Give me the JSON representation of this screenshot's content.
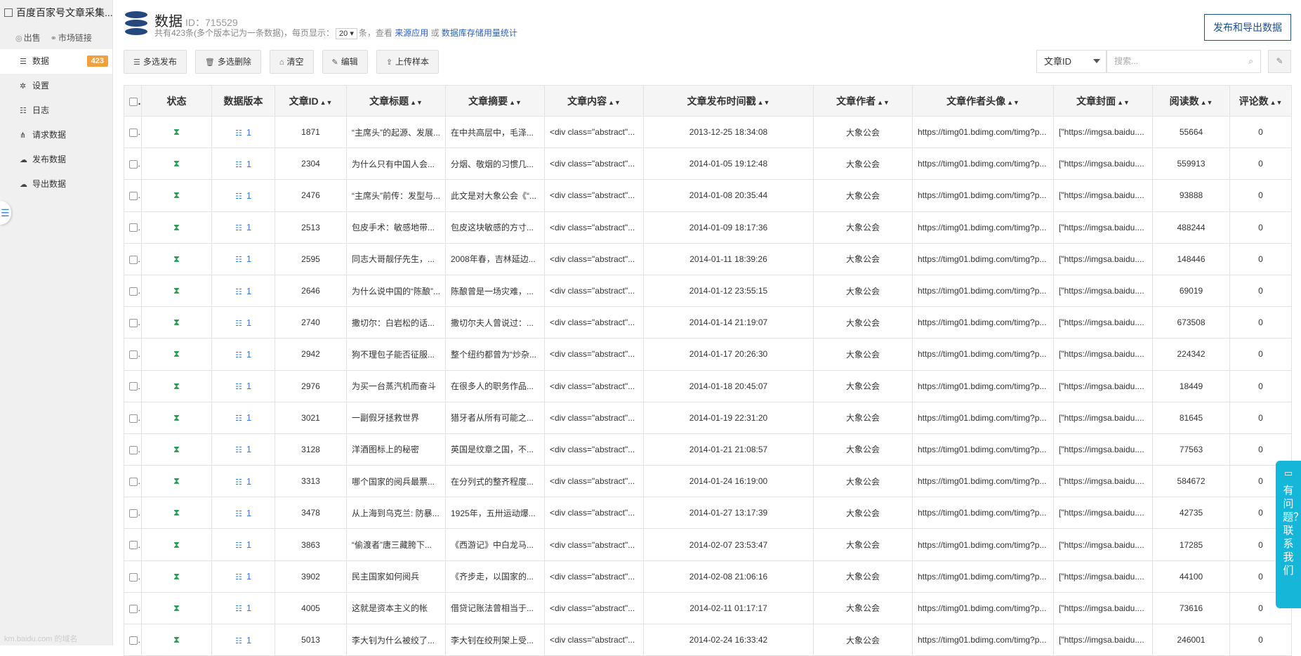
{
  "app": {
    "title": "百度百家号文章采集..."
  },
  "sidebar": {
    "links": [
      {
        "label": "出售"
      },
      {
        "label": "市场链接"
      }
    ],
    "items": [
      {
        "label": "数据",
        "badge": "423"
      },
      {
        "label": "设置"
      },
      {
        "label": "日志"
      },
      {
        "label": "请求数据"
      },
      {
        "label": "发布数据"
      },
      {
        "label": "导出数据"
      }
    ],
    "watermark": "km.baidu.com 的域名"
  },
  "header": {
    "title": "数据",
    "id_text": "ID：715529",
    "sub_prefix": "共有423条(多个版本记为一条数据)，每页显示：",
    "page_size": "20",
    "sub_mid": "条，查看",
    "link_source": "来源应用",
    "sub_or": "或",
    "link_storage": "数据库存储用量统计",
    "publish_button": "发布和导出数据"
  },
  "toolbar": {
    "multi_publish": "多选发布",
    "multi_delete": "多选删除",
    "clear": "清空",
    "edit": "编辑",
    "upload_sample": "上传样本"
  },
  "search": {
    "field": "文章ID",
    "placeholder": "搜索..."
  },
  "table": {
    "columns": [
      "状态",
      "数据版本",
      "文章ID",
      "文章标题",
      "文章摘要",
      "文章内容",
      "文章发布时间戳",
      "文章作者",
      "文章作者头像",
      "文章封面",
      "阅读数",
      "评论数"
    ],
    "rows": [
      [
        "1",
        "1871",
        "“主席头”的起源、发展...",
        "在中共高层中，毛泽...",
        "<div class=\"abstract\"...",
        "2013-12-25 18:34:08",
        "大象公会",
        "https://timg01.bdimg.com/timg?p...",
        "[\"https://imgsa.baidu....",
        "55664",
        "0"
      ],
      [
        "1",
        "2304",
        "为什么只有中国人会...",
        "分烟、敬烟的习惯几...",
        "<div class=\"abstract\"...",
        "2014-01-05 19:12:48",
        "大象公会",
        "https://timg01.bdimg.com/timg?p...",
        "[\"https://imgsa.baidu....",
        "559913",
        "0"
      ],
      [
        "1",
        "2476",
        "“主席头”前传：发型与...",
        "此文是对大象公会《“...",
        "<div class=\"abstract\"...",
        "2014-01-08 20:35:44",
        "大象公会",
        "https://timg01.bdimg.com/timg?p...",
        "[\"https://imgsa.baidu....",
        "93888",
        "0"
      ],
      [
        "1",
        "2513",
        "包皮手术：敏感地带...",
        "包皮这块敏感的方寸...",
        "<div class=\"abstract\"...",
        "2014-01-09 18:17:36",
        "大象公会",
        "https://timg01.bdimg.com/timg?p...",
        "[\"https://imgsa.baidu....",
        "488244",
        "0"
      ],
      [
        "1",
        "2595",
        "同志大哥靓仔先生，...",
        "2008年春，吉林延边...",
        "<div class=\"abstract\"...",
        "2014-01-11 18:39:26",
        "大象公会",
        "https://timg01.bdimg.com/timg?p...",
        "[\"https://imgsa.baidu....",
        "148446",
        "0"
      ],
      [
        "1",
        "2646",
        "为什么说中国的“陈酿”...",
        "陈酿曾是一场灾难，...",
        "<div class=\"abstract\"...",
        "2014-01-12 23:55:15",
        "大象公会",
        "https://timg01.bdimg.com/timg?p...",
        "[\"https://imgsa.baidu....",
        "69019",
        "0"
      ],
      [
        "1",
        "2740",
        "撒切尔：白岩松的话...",
        "撒切尔夫人曾说过：...",
        "<div class=\"abstract\"...",
        "2014-01-14 21:19:07",
        "大象公会",
        "https://timg01.bdimg.com/timg?p...",
        "[\"https://imgsa.baidu....",
        "673508",
        "0"
      ],
      [
        "1",
        "2942",
        "狗不理包子能否征服...",
        "整个纽约都曾为“炒杂...",
        "<div class=\"abstract\"...",
        "2014-01-17 20:26:30",
        "大象公会",
        "https://timg01.bdimg.com/timg?p...",
        "[\"https://imgsa.baidu....",
        "224342",
        "0"
      ],
      [
        "1",
        "2976",
        "为买一台蒸汽机而奋斗",
        "在很多人的职务作品...",
        "<div class=\"abstract\"...",
        "2014-01-18 20:45:07",
        "大象公会",
        "https://timg01.bdimg.com/timg?p...",
        "[\"https://imgsa.baidu....",
        "18449",
        "0"
      ],
      [
        "1",
        "3021",
        "一副假牙拯救世界",
        "猎牙者从所有可能之...",
        "<div class=\"abstract\"...",
        "2014-01-19 22:31:20",
        "大象公会",
        "https://timg01.bdimg.com/timg?p...",
        "[\"https://imgsa.baidu....",
        "81645",
        "0"
      ],
      [
        "1",
        "3128",
        "洋酒图标上的秘密",
        "英国是纹章之国，不...",
        "<div class=\"abstract\"...",
        "2014-01-21 21:08:57",
        "大象公会",
        "https://timg01.bdimg.com/timg?p...",
        "[\"https://imgsa.baidu....",
        "77563",
        "0"
      ],
      [
        "1",
        "3313",
        "哪个国家的阅兵最票...",
        "在分列式的整齐程度...",
        "<div class=\"abstract\"...",
        "2014-01-24 16:19:00",
        "大象公会",
        "https://timg01.bdimg.com/timg?p...",
        "[\"https://imgsa.baidu....",
        "584672",
        "0"
      ],
      [
        "1",
        "3478",
        "从上海到乌克兰: 防暴...",
        "1925年，五卅运动爆...",
        "<div class=\"abstract\"...",
        "2014-01-27 13:17:39",
        "大象公会",
        "https://timg01.bdimg.com/timg?p...",
        "[\"https://imgsa.baidu....",
        "42735",
        "0"
      ],
      [
        "1",
        "3863",
        "“偷渡者”唐三藏胯下...",
        "《西游记》中白龙马...",
        "<div class=\"abstract\"...",
        "2014-02-07 23:53:47",
        "大象公会",
        "https://timg01.bdimg.com/timg?p...",
        "[\"https://imgsa.baidu....",
        "17285",
        "0"
      ],
      [
        "1",
        "3902",
        "民主国家如何阅兵",
        "《齐步走，以国家的...",
        "<div class=\"abstract\"...",
        "2014-02-08 21:06:16",
        "大象公会",
        "https://timg01.bdimg.com/timg?p...",
        "[\"https://imgsa.baidu....",
        "44100",
        "0"
      ],
      [
        "1",
        "4005",
        "这就是资本主义的帐",
        "借贷记账法曾相当于...",
        "<div class=\"abstract\"...",
        "2014-02-11 01:17:17",
        "大象公会",
        "https://timg01.bdimg.com/timg?p...",
        "[\"https://imgsa.baidu....",
        "73616",
        "0"
      ],
      [
        "1",
        "5013",
        "李大钊为什么被绞了...",
        "李大钊在绞刑架上受...",
        "<div class=\"abstract\"...",
        "2014-02-24 16:33:42",
        "大象公会",
        "https://timg01.bdimg.com/timg?p...",
        "[\"https://imgsa.baidu....",
        "246001",
        "0"
      ]
    ]
  },
  "help": {
    "label": "有问题？联系我们"
  }
}
